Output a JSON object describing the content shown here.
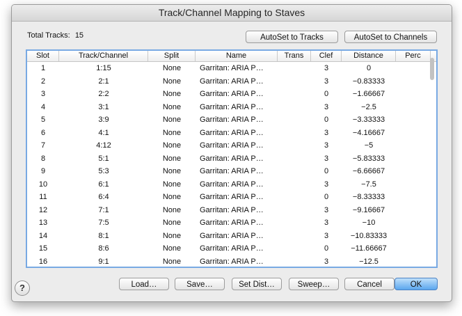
{
  "window": {
    "title": "Track/Channel Mapping to Staves"
  },
  "total_tracks": {
    "label": "Total Tracks:",
    "value": "15"
  },
  "buttons": {
    "autoset_tracks": "AutoSet to Tracks",
    "autoset_channels": "AutoSet to Channels",
    "load": "Load…",
    "save": "Save…",
    "set_dist": "Set Dist…",
    "sweep": "Sweep…",
    "cancel": "Cancel",
    "ok": "OK",
    "help": "?"
  },
  "table": {
    "columns": [
      "Slot",
      "Track/Channel",
      "Split",
      "Name",
      "Trans",
      "Clef",
      "Distance",
      "Perc"
    ],
    "rows": [
      {
        "slot": "1",
        "track": "1:15",
        "split": "None",
        "name": "Garritan: ARIA P…",
        "trans": "",
        "clef": "3",
        "distance": "0",
        "perc": ""
      },
      {
        "slot": "2",
        "track": "2:1",
        "split": "None",
        "name": "Garritan: ARIA P…",
        "trans": "",
        "clef": "3",
        "distance": "−0.83333",
        "perc": ""
      },
      {
        "slot": "3",
        "track": "2:2",
        "split": "None",
        "name": "Garritan: ARIA P…",
        "trans": "",
        "clef": "0",
        "distance": "−1.66667",
        "perc": ""
      },
      {
        "slot": "4",
        "track": "3:1",
        "split": "None",
        "name": "Garritan: ARIA P…",
        "trans": "",
        "clef": "3",
        "distance": "−2.5",
        "perc": ""
      },
      {
        "slot": "5",
        "track": "3:9",
        "split": "None",
        "name": "Garritan: ARIA P…",
        "trans": "",
        "clef": "0",
        "distance": "−3.33333",
        "perc": ""
      },
      {
        "slot": "6",
        "track": "4:1",
        "split": "None",
        "name": "Garritan: ARIA P…",
        "trans": "",
        "clef": "3",
        "distance": "−4.16667",
        "perc": ""
      },
      {
        "slot": "7",
        "track": "4:12",
        "split": "None",
        "name": "Garritan: ARIA P…",
        "trans": "",
        "clef": "3",
        "distance": "−5",
        "perc": ""
      },
      {
        "slot": "8",
        "track": "5:1",
        "split": "None",
        "name": "Garritan: ARIA P…",
        "trans": "",
        "clef": "3",
        "distance": "−5.83333",
        "perc": ""
      },
      {
        "slot": "9",
        "track": "5:3",
        "split": "None",
        "name": "Garritan: ARIA P…",
        "trans": "",
        "clef": "0",
        "distance": "−6.66667",
        "perc": ""
      },
      {
        "slot": "10",
        "track": "6:1",
        "split": "None",
        "name": "Garritan: ARIA P…",
        "trans": "",
        "clef": "3",
        "distance": "−7.5",
        "perc": ""
      },
      {
        "slot": "11",
        "track": "6:4",
        "split": "None",
        "name": "Garritan: ARIA P…",
        "trans": "",
        "clef": "0",
        "distance": "−8.33333",
        "perc": ""
      },
      {
        "slot": "12",
        "track": "7:1",
        "split": "None",
        "name": "Garritan: ARIA P…",
        "trans": "",
        "clef": "3",
        "distance": "−9.16667",
        "perc": ""
      },
      {
        "slot": "13",
        "track": "7:5",
        "split": "None",
        "name": "Garritan: ARIA P…",
        "trans": "",
        "clef": "3",
        "distance": "−10",
        "perc": ""
      },
      {
        "slot": "14",
        "track": "8:1",
        "split": "None",
        "name": "Garritan: ARIA P…",
        "trans": "",
        "clef": "3",
        "distance": "−10.83333",
        "perc": ""
      },
      {
        "slot": "15",
        "track": "8:6",
        "split": "None",
        "name": "Garritan: ARIA P…",
        "trans": "",
        "clef": "0",
        "distance": "−11.66667",
        "perc": ""
      },
      {
        "slot": "16",
        "track": "9:1",
        "split": "None",
        "name": "Garritan: ARIA P…",
        "trans": "",
        "clef": "3",
        "distance": "−12.5",
        "perc": ""
      }
    ]
  },
  "colors": {
    "table_focus_border": "#78a9e3",
    "default_button": "#5ba6ee"
  }
}
